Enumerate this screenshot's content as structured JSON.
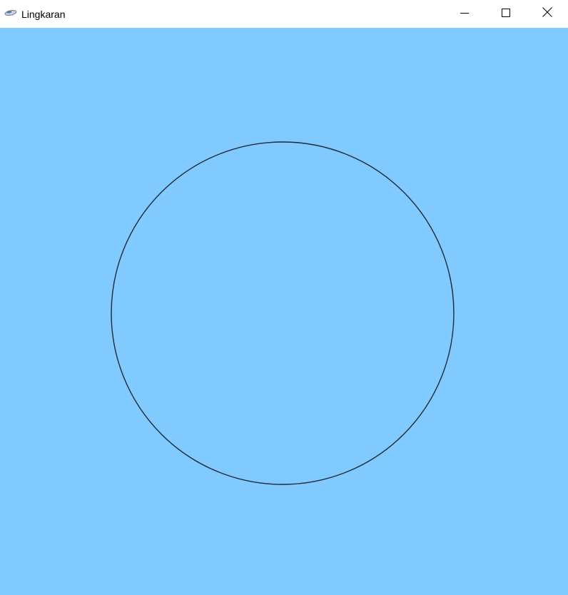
{
  "window": {
    "title": "Lingkaran",
    "app_icon": "opengl-app-icon",
    "controls": {
      "minimize_icon": "minimize-icon",
      "maximize_icon": "maximize-icon",
      "close_icon": "close-icon"
    }
  },
  "canvas": {
    "background_color": "#80CAFF",
    "shape": "circle",
    "stroke_color": "#1c2a38",
    "fill": "none"
  }
}
